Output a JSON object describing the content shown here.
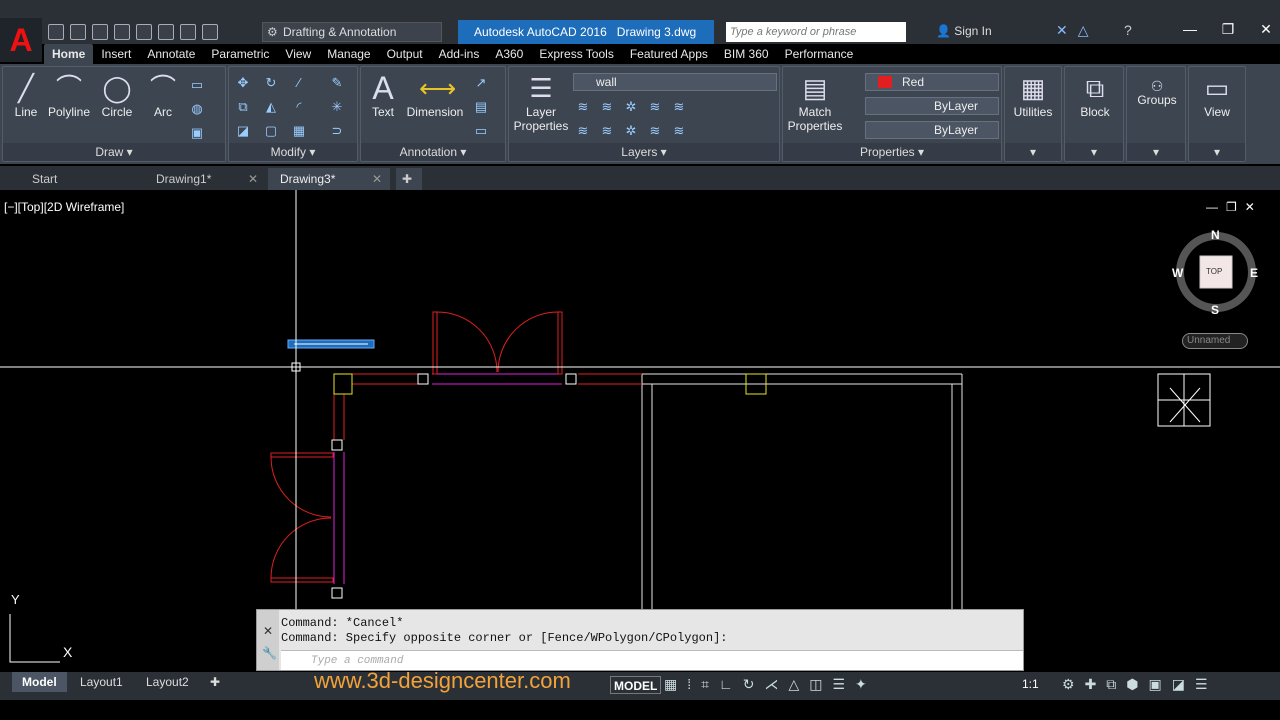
{
  "app": {
    "title": "Autodesk AutoCAD 2016",
    "document": "Drawing 3.dwg",
    "workspace": "Drafting & Annotation",
    "search_placeholder": "Type a keyword or phrase",
    "sign_in": "Sign In"
  },
  "ribbon_tabs": [
    "Home",
    "Insert",
    "Annotate",
    "Parametric",
    "View",
    "Manage",
    "Output",
    "Add-ins",
    "A360",
    "Express Tools",
    "Featured Apps",
    "BIM 360",
    "Performance"
  ],
  "ribbon": {
    "draw": {
      "title": "Draw",
      "tools": [
        "Line",
        "Polyline",
        "Circle",
        "Arc"
      ]
    },
    "modify": {
      "title": "Modify"
    },
    "annotation": {
      "title": "Annotation",
      "tools": [
        "Text",
        "Dimension"
      ]
    },
    "layers": {
      "title": "Layers",
      "tool_l1": "Layer",
      "tool_l2": "Properties",
      "current_layer": "wall"
    },
    "properties": {
      "title": "Properties",
      "match_l1": "Match",
      "match_l2": "Properties",
      "color": "Red",
      "linetype": "ByLayer",
      "lineweight": "ByLayer"
    },
    "utilities": "Utilities",
    "block": "Block",
    "groups": "Groups",
    "view": "View"
  },
  "doc_tabs": [
    "Start",
    "Drawing1*",
    "Drawing3*"
  ],
  "viewport": {
    "label": "[−][Top][2D Wireframe]",
    "viewcube": {
      "n": "N",
      "s": "S",
      "e": "E",
      "w": "W",
      "face": "TOP"
    },
    "ucs_name": "Unnamed",
    "axis_x": "X",
    "axis_y": "Y"
  },
  "command": {
    "line1": "Command: *Cancel*",
    "line2": "Command: Specify opposite corner or [Fence/WPolygon/CPolygon]:",
    "placeholder": "Type a command"
  },
  "layout_tabs": [
    "Model",
    "Layout1",
    "Layout2"
  ],
  "watermark": "www.3d-designcenter.com",
  "status": {
    "model": "MODEL",
    "scale": "1:1"
  },
  "colors": {
    "accent": "#1d6dba",
    "wall_magenta": "#e020e0",
    "door_red": "#e02020",
    "yellow": "#e6e628",
    "window_title": "#2b3036"
  }
}
